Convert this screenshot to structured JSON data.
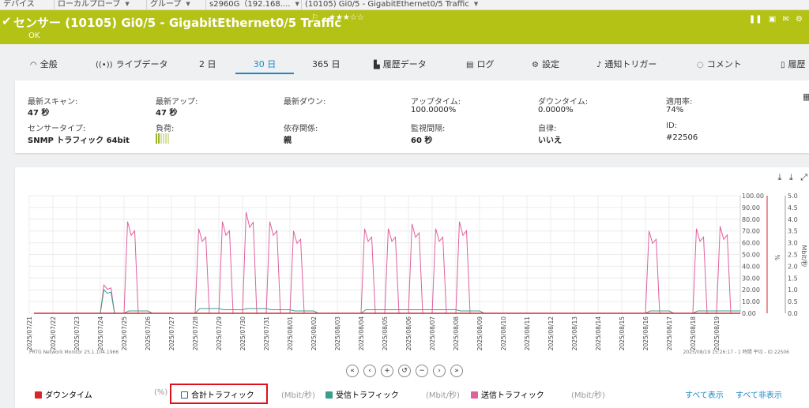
{
  "breadcrumb": [
    {
      "label": "デバイス"
    },
    {
      "label": "ローカルプローブ"
    },
    {
      "label": "グループ"
    },
    {
      "label": "s2960G（192.168...."
    },
    {
      "label": "(10105) Gi0/5 - GigabitEthernet0/5 Traffic"
    }
  ],
  "header": {
    "title": "センサー (10105) Gi0/5 - GigabitEthernet0/5 Traffic",
    "status": "OK",
    "stars": "★★★☆☆",
    "colors": {
      "bar": "#b3c214"
    }
  },
  "tabs": [
    {
      "label": "全般",
      "icon": "gauge-icon"
    },
    {
      "label": "ライブデータ",
      "icon": "live-signal-icon"
    },
    {
      "label": "2 日"
    },
    {
      "label": "30 日",
      "active": true
    },
    {
      "label": "365 日"
    },
    {
      "label": "履歴データ",
      "icon": "bar-chart-icon"
    },
    {
      "label": "ログ",
      "icon": "log-list-icon"
    },
    {
      "label": "設定",
      "icon": "gear-icon"
    },
    {
      "label": "通知トリガー",
      "icon": "bell-icon"
    },
    {
      "label": "コメント",
      "icon": "comment-icon"
    },
    {
      "label": "履歴",
      "icon": "history-icon"
    }
  ],
  "info": {
    "row1": [
      {
        "label": "最新スキャン:",
        "value": "47 秒"
      },
      {
        "label": "最新アップ:",
        "value": "47 秒"
      },
      {
        "label": "最新ダウン:",
        "value": ""
      },
      {
        "label": "アップタイム:",
        "value": "100.0000%"
      },
      {
        "label": "ダウンタイム:",
        "value": "0.0000%"
      },
      {
        "label": "適用率:",
        "value": "74%"
      }
    ],
    "row2": [
      {
        "label": "センサータイプ:",
        "value": "SNMP トラフィック 64bit"
      },
      {
        "label": "負荷:",
        "value": ""
      },
      {
        "label": "依存関係:",
        "value": "親"
      },
      {
        "label": "監視間隔:",
        "value": "60 秒"
      },
      {
        "label": "自律:",
        "value": "いいえ"
      },
      {
        "label": "ID:",
        "value": "#22506"
      }
    ]
  },
  "chart_footer": {
    "left": "PRTG Network Monitor 25.1.104.1966",
    "right": "2025/08/19 15:26:17 - 1 時間 平均 - ID 22506"
  },
  "legend": [
    {
      "label": "ダウンタイム",
      "unit": "(%)",
      "color": "#d9262b",
      "checked": true
    },
    {
      "label": "合計トラフィック",
      "unit": "(Mbit/秒)",
      "color": "#3a5a8c",
      "checked": false
    },
    {
      "label": "受信トラフィック",
      "unit": "(Mbit/秒)",
      "color": "#3a9e8c",
      "checked": true
    },
    {
      "label": "送信トラフィック",
      "unit": "(Mbit/秒)",
      "color": "#e0609e",
      "checked": true
    }
  ],
  "links": {
    "show_all": "すべて表示",
    "hide_all": "すべて非表示"
  },
  "chart_data": {
    "type": "line",
    "x": [
      "2025/07/21",
      "2025/07/22",
      "2025/07/23",
      "2025/07/24",
      "2025/07/25",
      "2025/07/26",
      "2025/07/27",
      "2025/07/28",
      "2025/07/29",
      "2025/07/30",
      "2025/07/31",
      "2025/08/01",
      "2025/08/02",
      "2025/08/03",
      "2025/08/04",
      "2025/08/05",
      "2025/08/06",
      "2025/08/07",
      "2025/08/08",
      "2025/08/09",
      "2025/08/10",
      "2025/08/11",
      "2025/08/12",
      "2025/08/13",
      "2025/08/14",
      "2025/08/15",
      "2025/08/16",
      "2025/08/17",
      "2025/08/18",
      "2025/08/19"
    ],
    "y_left": {
      "label": "%",
      "ticks": [
        "100.00",
        "90.00",
        "80.00",
        "70.00",
        "60.00",
        "50.00",
        "40.00",
        "30.00",
        "20.00",
        "10.00",
        "0.00"
      ],
      "ylim": [
        0,
        100
      ]
    },
    "y_right": {
      "label": "Mbit/秒",
      "ticks": [
        "5.0",
        "4.5",
        "4.0",
        "3.5",
        "3.0",
        "2.5",
        "2.0",
        "1.5",
        "1.0",
        "0.5",
        "0.0"
      ],
      "ylim": [
        0,
        5
      ]
    },
    "series": [
      {
        "name": "送信トラフィック",
        "color": "#e0609e",
        "values": [
          0,
          0,
          0,
          1.2,
          3.9,
          0,
          0,
          3.6,
          3.9,
          4.3,
          3.9,
          3.5,
          0,
          0,
          3.6,
          3.6,
          3.8,
          3.6,
          3.9,
          0,
          0,
          0,
          0,
          0,
          0,
          0,
          3.5,
          0,
          3.6,
          3.7
        ]
      },
      {
        "name": "受信トラフィック",
        "color": "#3a9e8c",
        "values": [
          0,
          0,
          0,
          1.0,
          0.1,
          0,
          0,
          0.2,
          0.15,
          0.2,
          0.15,
          0.1,
          0,
          0,
          0.15,
          0.15,
          0.15,
          0.15,
          0.1,
          0,
          0,
          0,
          0,
          0,
          0,
          0,
          0.1,
          0,
          0.1,
          0.1
        ]
      },
      {
        "name": "ダウンタイム",
        "color": "#d9262b",
        "values": [
          0,
          0,
          0,
          0,
          0,
          0,
          0,
          0,
          0,
          0,
          0,
          0,
          0,
          0,
          0,
          0,
          0,
          0,
          0,
          0,
          0,
          0,
          0,
          0,
          0,
          0,
          0,
          0,
          0,
          0
        ]
      }
    ],
    "grid": true,
    "legend_position": "bottom"
  }
}
